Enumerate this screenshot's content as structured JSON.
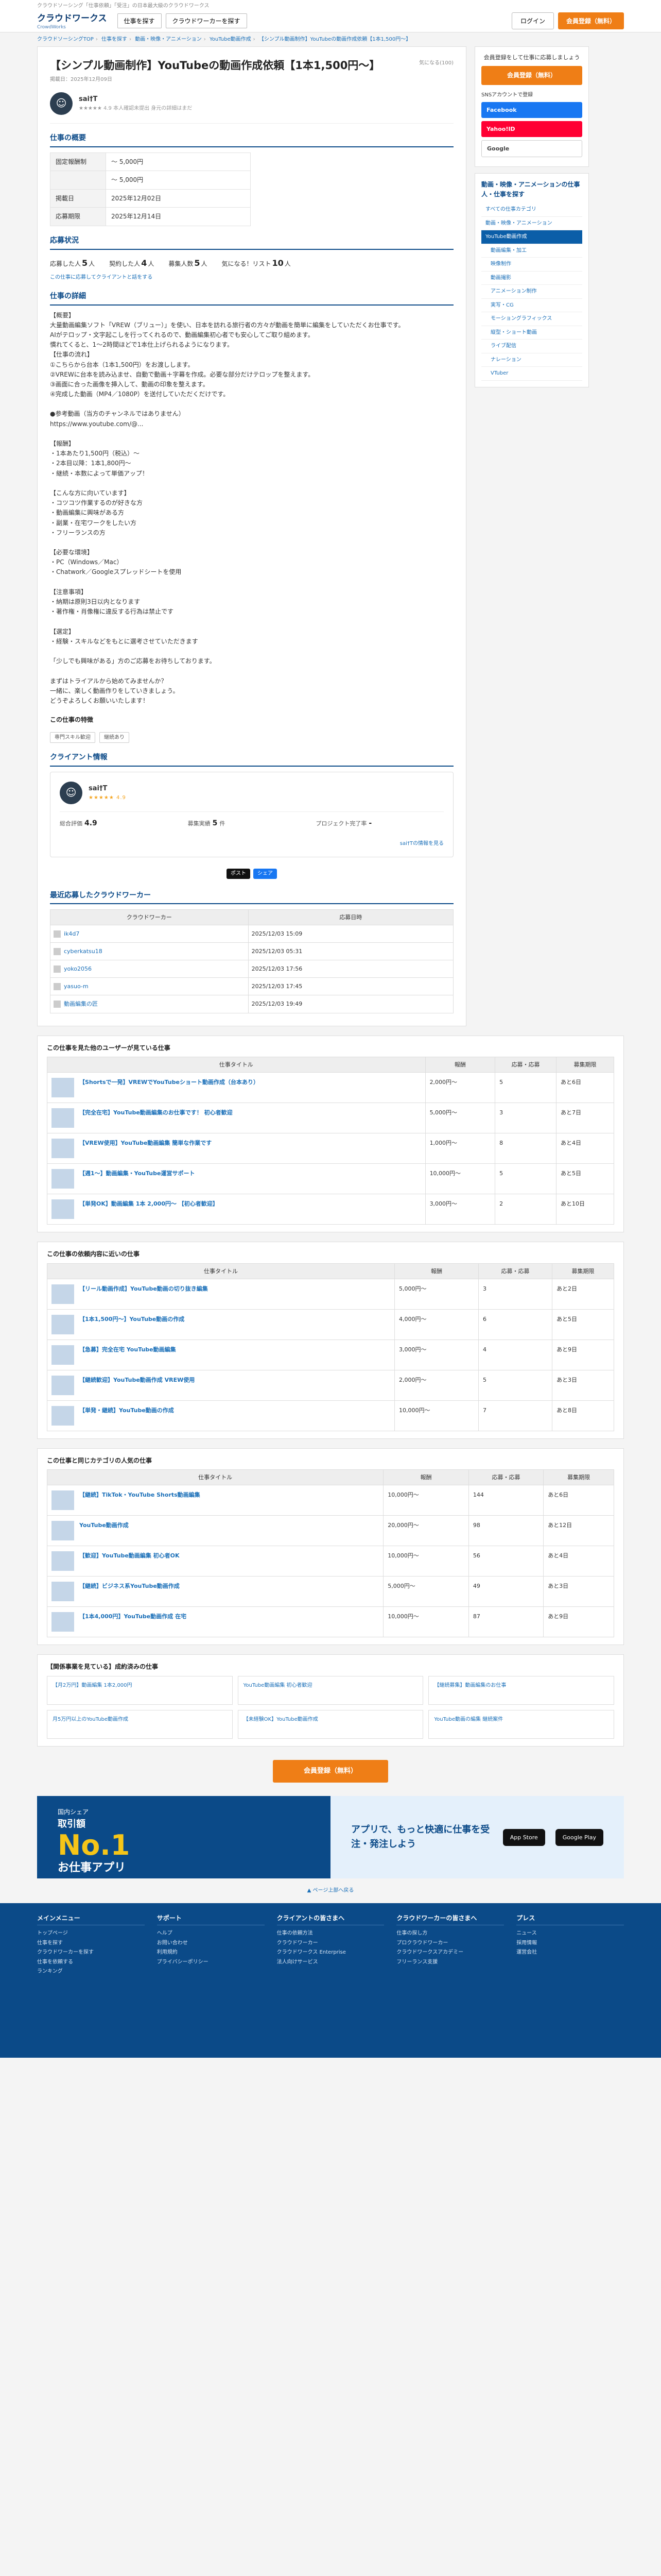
{
  "header": {
    "tagline": "クラウドソーシング「仕事依頼」「受注」の日本最大級のクラウドワークス",
    "logo": "クラウドワークス",
    "logo_sub": "CrowdWorks",
    "btn_find_work": "仕事を探す",
    "btn_find_worker": "クラウドワーカーを探す",
    "login": "ログイン",
    "register": "会員登録（無料）"
  },
  "breadcrumb": [
    "クラウドソーシングTOP",
    "仕事を探す",
    "動画・映像・アニメーション",
    "YouTube動画作成",
    "【シンプル動画制作】YouTubeの動画作成依頼【1本1,500円〜】"
  ],
  "job": {
    "title": "【シンプル動画制作】YouTubeの動画作成依頼【1本1,500円〜】",
    "favorite": "気になる(100)",
    "posted": "掲載日：2025年12月09日",
    "client_name": "sai†T",
    "client_meta": "★★★★★ 4.9 本人確認未提出 身元の詳細はまだ",
    "stars": "★★★★★",
    "overview_h": "仕事の概要",
    "kv": [
      [
        "固定報酬制",
        "〜 5,000円"
      ],
      [
        "",
        "〜 5,000円"
      ],
      [
        "掲載日",
        "2025年12月02日"
      ],
      [
        "応募期限",
        "2025年12月14日"
      ]
    ],
    "apps_h": "応募状況",
    "apps": [
      [
        "応募した人",
        "5",
        "人"
      ],
      [
        "契約した人",
        "4",
        "人"
      ],
      [
        "募集人数",
        "5",
        "人"
      ],
      [
        "気になる！リスト",
        "10",
        "人"
      ]
    ],
    "apps_note": "この仕事に応募してクライアントと話をする",
    "detail_h": "仕事の詳細",
    "detail": "【概要】\n大量動画編集ソフト「VREW（ブリュー）」を使い、日本を訪れる旅行者の方々が動画を簡単に編集をしていただくお仕事です。\nAIがテロップ・文字起こしを行ってくれるので、動画編集初心者でも安心してご取り組めます。\n慣れてくると、1〜2時間ほどで1本仕上げられるようになります。\n【仕事の流れ】\n①こちらから台本（1本1,500円）をお渡しします。\n②VREWに台本を読み込ませ、自動で動画＋字幕を作成。必要な部分だけテロップを整えます。\n③画面に合った画像を挿入して、動画の印象を整えます。\n④完成した動画（MP4／1080P）を送付していただくだけです。\n\n●参考動画（当方のチャンネルではありません）\nhttps://www.youtube.com/@...\n\n【報酬】\n・1本あたり1,500円（税込）〜\n・2本目以降：1本1,800円〜\n・継続・本数によって単価アップ！\n\n【こんな方に向いています】\n・コツコツ作業するのが好きな方\n・動画編集に興味がある方\n・副業・在宅ワークをしたい方\n・フリーランスの方\n\n【必要な環境】\n・PC（Windows／Mac）\n・Chatwork／Googleスプレッドシートを使用\n\n【注意事項】\n・納期は原則3日以内となります\n・著作権・肖像権に違反する行為は禁止です\n\n【選定】\n・経験・スキルなどをもとに選考させていただきます\n\n「少しでも興味がある」方のご応募をお待ちしております。\n\nまずはトライアルから始めてみませんか？\n一緒に、楽しく動画作りをしていきましょう。\nどうぞよろしくお願いいたします！",
    "genre_h": "この仕事の特徴",
    "tags": [
      "専門スキル歓迎",
      "継続あり"
    ]
  },
  "client_box": {
    "h": "クライアント情報",
    "name": "sai†T",
    "stars": "★★★★★ 4.9",
    "stats": [
      [
        "総合評価",
        "4.9",
        ""
      ],
      [
        "募集実績",
        "5",
        "件"
      ],
      [
        "プロジェクト完了率",
        "-",
        ""
      ]
    ],
    "more": "sai†Tの情報を見る"
  },
  "share": [
    "ポスト",
    "シェア"
  ],
  "workers": {
    "h": "最近応募したクラウドワーカー",
    "cols": [
      "クラウドワーカー",
      "応募日時"
    ],
    "rows": [
      [
        "ik4d7",
        "2025/12/03 15:09"
      ],
      [
        "cyberkatsu18",
        "2025/12/03 05:31"
      ],
      [
        "yoko2056",
        "2025/12/03 17:56"
      ],
      [
        "yasuo-m",
        "2025/12/03 17:45"
      ],
      [
        "動画編集の匠",
        "2025/12/03 19:49"
      ]
    ]
  },
  "side": {
    "btn": "会員登録（無料）",
    "text": "会員登録をして仕事に応募しましょう",
    "social_h": "SNSアカウントで登録",
    "social": [
      "Facebook",
      "Yahoo!ID",
      "Google"
    ],
    "menu_h": "動画・映像・アニメーションの仕事人・仕事を探す",
    "menu": [
      "すべての仕事カテゴリ",
      "動画・映像・アニメーション",
      "YouTube動画作成",
      "動画編集・加工",
      "映像制作",
      "動画撮影",
      "アニメーション制作",
      "実写・CG",
      "モーショングラフィックス",
      "縦型・ショート動画",
      "ライブ配信",
      "ナレーション",
      "VTuber"
    ]
  },
  "similar": {
    "h": "この仕事を見た他のユーザーが見ている仕事",
    "cols": [
      "仕事タイトル",
      "報酬",
      "応募・応募",
      "募集期限"
    ],
    "rows": [
      [
        "【Shortsで一発】VREWでYouTubeショート動画作成（台本あり）",
        "2,000円〜",
        "5",
        "あと6日"
      ],
      [
        "【完全在宅】YouTube動画編集のお仕事です！ 初心者歓迎",
        "5,000円〜",
        "3",
        "あと7日"
      ],
      [
        "【VREW使用】YouTube動画編集 簡単な作業です",
        "1,000円〜",
        "8",
        "あと4日"
      ],
      [
        "【週1〜】動画編集・YouTube運営サポート",
        "10,000円〜",
        "5",
        "あと5日"
      ],
      [
        "【単発OK】動画編集 1本 2,000円〜 【初心者歓迎】",
        "3,000円〜",
        "2",
        "あと10日"
      ]
    ]
  },
  "others": {
    "h": "この仕事の依頼内容に近いの仕事",
    "rows": [
      [
        "【リール動画作成】YouTube動画の切り抜き編集",
        "5,000円〜",
        "3",
        "あと2日"
      ],
      [
        "【1本1,500円〜】YouTube動画の作成",
        "4,000円〜",
        "6",
        "あと5日"
      ],
      [
        "【急募】完全在宅 YouTube動画編集",
        "3,000円〜",
        "4",
        "あと9日"
      ],
      [
        "【継続歓迎】YouTube動画作成 VREW使用",
        "2,000円〜",
        "5",
        "あと3日"
      ],
      [
        "【単発・継続】YouTube動画の作成",
        "10,000円〜",
        "7",
        "あと8日"
      ]
    ]
  },
  "categories": {
    "h": "この仕事と同じカテゴリの人気の仕事",
    "rows": [
      [
        "【継続】TikTok・YouTube Shorts動画編集",
        "10,000円〜",
        "144",
        "あと6日"
      ],
      [
        "YouTube動画作成",
        "20,000円〜",
        "98",
        "あと12日"
      ],
      [
        "【歓迎】YouTube動画編集 初心者OK",
        "10,000円〜",
        "56",
        "あと4日"
      ],
      [
        "【継続】ビジネス系YouTube動画作成",
        "5,000円〜",
        "49",
        "あと3日"
      ],
      [
        "【1本4,000円】YouTube動画作成 在宅",
        "10,000円〜",
        "87",
        "あと9日"
      ]
    ]
  },
  "related": {
    "h": "【関係事業を見ている】成約済みの仕事",
    "items": [
      "【月2万円】動画編集 1本2,000円",
      "YouTube動画編集 初心者歓迎",
      "【継続募集】動画編集のお仕事",
      "月5万円以上のYouTube動画作成",
      "【未経験OK】YouTube動画作成",
      "YouTube動画の編集 継続案件"
    ]
  },
  "cta": "会員登録（無料）",
  "appban": {
    "left1": "国内シェア",
    "left2": "取引額",
    "no1": "No.1",
    "left3": "お仕事アプリ",
    "right": "アプリで、もっと快適に仕事を受注・発注しよう",
    "stores": [
      "App Store",
      "Google Play"
    ]
  },
  "pagetop": "▲ ページ上部へ戻る",
  "footer": [
    [
      "メインメニュー",
      "トップページ",
      "仕事を探す",
      "クラウドワーカーを探す",
      "仕事を依頼する",
      "ランキング"
    ],
    [
      "サポート",
      "ヘルプ",
      "お問い合わせ",
      "利用規約",
      "プライバシーポリシー"
    ],
    [
      "クライアントの皆さまへ",
      "仕事の依頼方法",
      "クラウドワーカー",
      "クラウドワークス Enterprise",
      "法人向けサービス"
    ],
    [
      "クラウドワーカーの皆さまへ",
      "仕事の探し方",
      "プロクラウドワーカー",
      "クラウドワークスアカデミー",
      "フリーランス支援"
    ],
    [
      "プレス",
      "ニュース",
      "採用情報",
      "運営会社"
    ]
  ]
}
